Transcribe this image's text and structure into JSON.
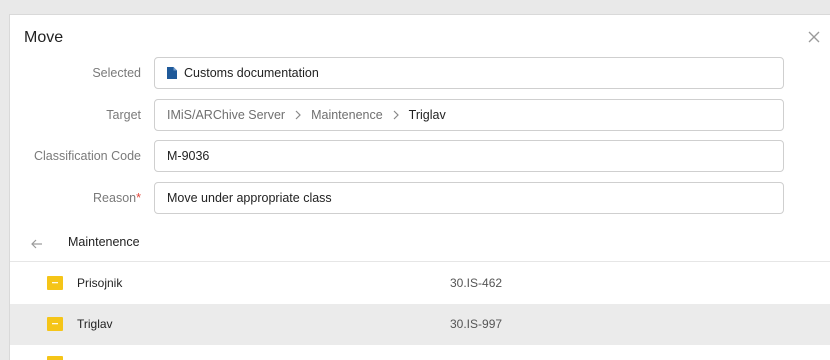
{
  "dialog": {
    "title": "Move",
    "close_icon": "close-icon"
  },
  "form": {
    "selected": {
      "label": "Selected",
      "value": "Customs documentation",
      "icon": "document-icon",
      "icon_color": "#1f5a9a"
    },
    "target": {
      "label": "Target",
      "path": [
        "IMiS/ARChive Server",
        "Maintenence",
        "Triglav"
      ],
      "separator_icon": "chevron-right-icon"
    },
    "classification_code": {
      "label": "Classification Code",
      "value": "M-9036"
    },
    "reason": {
      "label": "Reason",
      "required_mark": "*",
      "value": "Move under appropriate class"
    }
  },
  "browser": {
    "back_icon": "arrow-left-icon",
    "current_folder": "Maintenence",
    "items": [
      {
        "name": "Prisojnik",
        "code": "30.IS-462",
        "selected": false,
        "icon": "folder-icon"
      },
      {
        "name": "Triglav",
        "code": "30.IS-997",
        "selected": true,
        "icon": "folder-icon"
      }
    ]
  },
  "colors": {
    "folder": "#f5c518",
    "required": "#e2463a",
    "selected_row": "#ebebeb"
  }
}
